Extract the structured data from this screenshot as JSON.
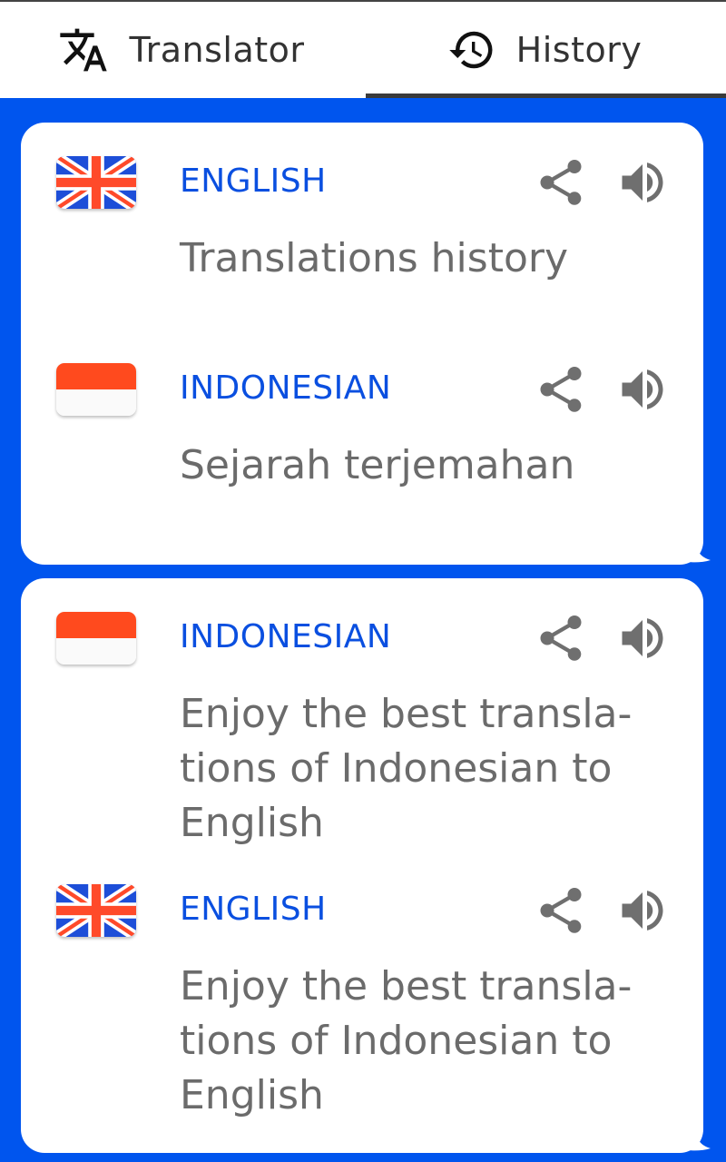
{
  "tabs": [
    {
      "label": "Translator",
      "icon": "translate-icon",
      "selected": false
    },
    {
      "label": "History",
      "icon": "history-icon",
      "selected": true
    }
  ],
  "colors": {
    "background": "#0055ee",
    "language_label": "#0a4fe0",
    "text": "#6b6b6b",
    "icon": "#6f6f6f",
    "tab_indicator": "#3a3a3a"
  },
  "history": [
    {
      "source": {
        "language": "ENGLISH",
        "flag": "uk-flag",
        "text": "Translations history"
      },
      "target": {
        "language": "INDONESIAN",
        "flag": "indonesia-flag",
        "text": "Sejarah terjemahan"
      }
    },
    {
      "source": {
        "language": "INDONESIAN",
        "flag": "indonesia-flag",
        "text": "Enjoy the best transla-tions of Indonesian to English"
      },
      "target": {
        "language": "ENGLISH",
        "flag": "uk-flag",
        "text": "Enjoy the best transla-tions of Indonesian to English"
      }
    }
  ]
}
